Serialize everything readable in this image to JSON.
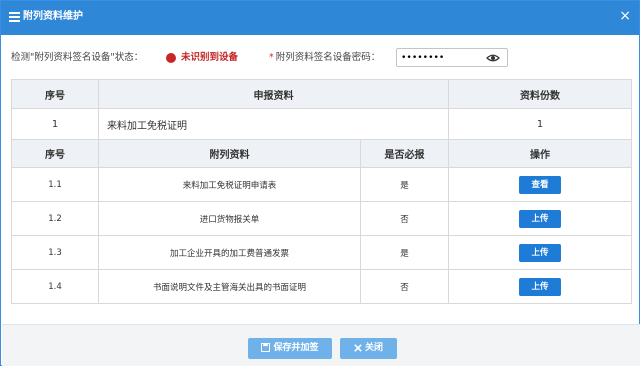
{
  "dialog": {
    "title": "附列资料维护",
    "close_glyph": "×"
  },
  "status": {
    "label": "检测\"附列资料签名设备\"状态：",
    "value": "未识别到设备",
    "value_color": "#c62828",
    "password_required_mark": "*",
    "password_label": "附列资料签名设备密码：",
    "password_value": "••••••••"
  },
  "declaration_table": {
    "headers": [
      "序号",
      "申报资料",
      "资料份数"
    ],
    "row": {
      "seq": "1",
      "name": "来料加工免税证明",
      "count": "1"
    }
  },
  "attachments_table": {
    "headers": [
      "序号",
      "附列资料",
      "是否必报",
      "操作"
    ],
    "rows": [
      {
        "seq": "1.1",
        "name": "来料加工免税证明申请表",
        "required": "是",
        "action": "查看"
      },
      {
        "seq": "1.2",
        "name": "进口货物报关单",
        "required": "否",
        "action": "上传"
      },
      {
        "seq": "1.3",
        "name": "加工企业开具的加工费普通发票",
        "required": "是",
        "action": "上传"
      },
      {
        "seq": "1.4",
        "name": "书面说明文件及主管海关出具的书面证明",
        "required": "否",
        "action": "上传"
      }
    ]
  },
  "footer": {
    "save_label": "保存并加签",
    "close_label": "关闭"
  },
  "colors": {
    "title_bar": "#2f87d8",
    "action_button": "#1e7bd6",
    "footer_button": "#6fb2ea"
  }
}
